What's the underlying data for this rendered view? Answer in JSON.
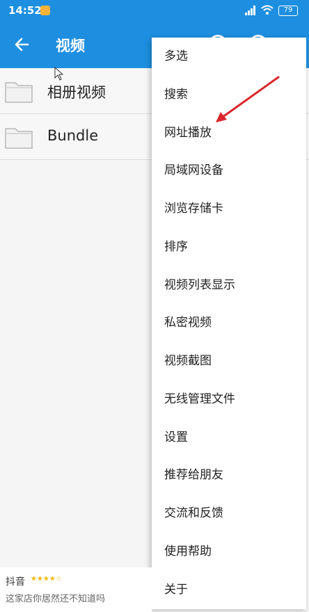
{
  "status_bar": {
    "time": "14:52",
    "battery": "79"
  },
  "app_bar": {
    "title": "视频"
  },
  "folders": [
    {
      "label": "相册视频"
    },
    {
      "label": "Bundle"
    }
  ],
  "menu": {
    "items": [
      {
        "label": "多选"
      },
      {
        "label": "搜索"
      },
      {
        "label": "网址播放"
      },
      {
        "label": "局域网设备"
      },
      {
        "label": "浏览存储卡"
      },
      {
        "label": "排序"
      },
      {
        "label": "视频列表显示"
      },
      {
        "label": "私密视频"
      },
      {
        "label": "视频截图"
      },
      {
        "label": "无线管理文件"
      },
      {
        "label": "设置"
      },
      {
        "label": "推荐给朋友"
      },
      {
        "label": "交流和反馈"
      },
      {
        "label": "使用帮助"
      },
      {
        "label": "关于"
      }
    ]
  },
  "footer": {
    "brand": "抖音",
    "stars": "★★★★☆",
    "desc": "这家店你居然还不知道吗"
  },
  "colors": {
    "primary": "#1e8fe0",
    "annotation_arrow": "#d9262c"
  }
}
